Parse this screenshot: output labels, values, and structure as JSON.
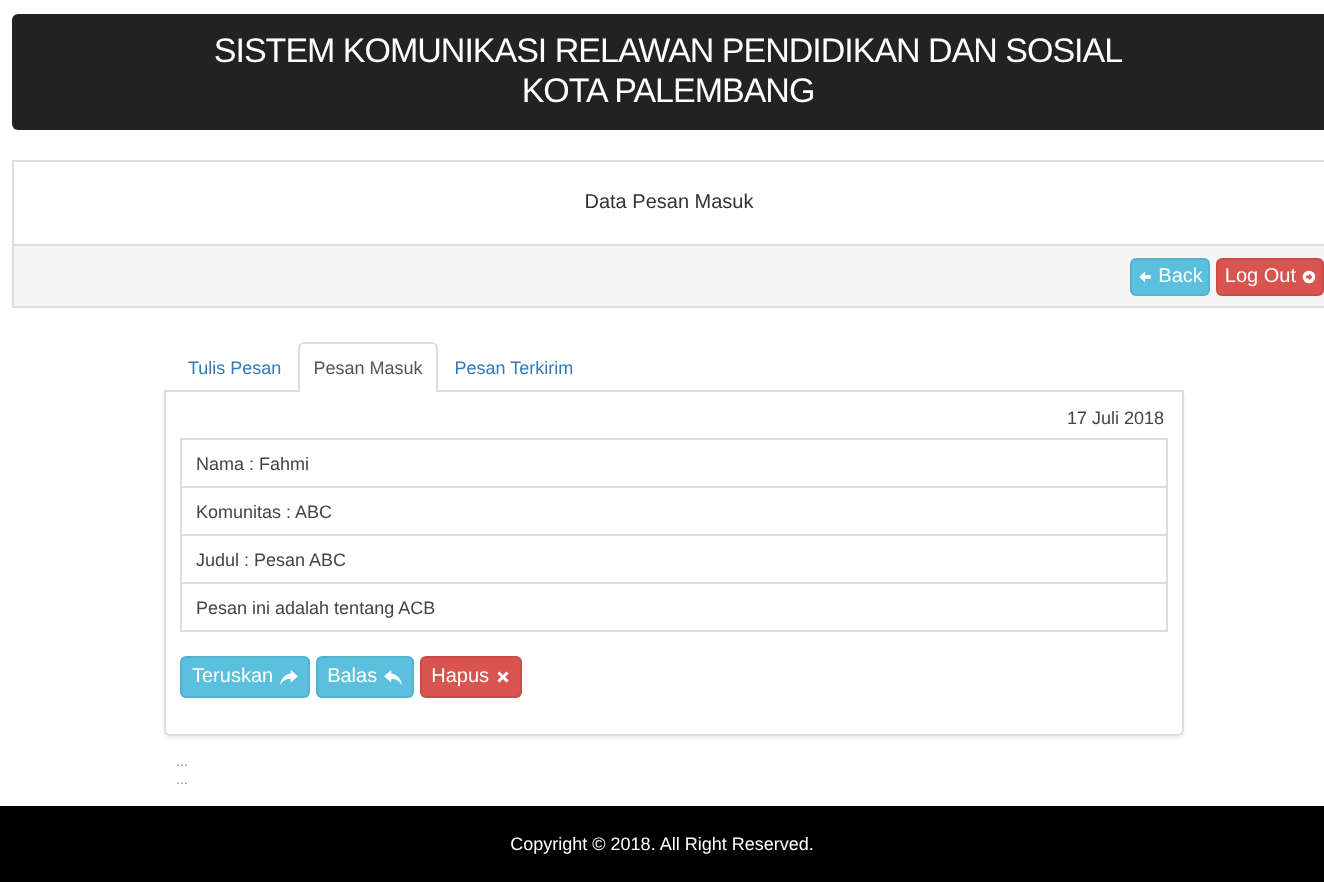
{
  "header": {
    "title_lines": [
      "SISTEM KOMUNIKASI RELAWAN PENDIDIKAN DAN SOSIAL",
      "KOTA PALEMBANG"
    ]
  },
  "page_title": "Data Pesan Masuk",
  "toolbar": {
    "buttons": [
      {
        "label": "Back",
        "kind": "info"
      },
      {
        "label": "Log Out",
        "kind": "danger"
      }
    ]
  },
  "tabs": [
    {
      "label": "Tulis Pesan",
      "selected": false
    },
    {
      "label": "Pesan Masuk",
      "selected": true
    },
    {
      "label": "Pesan Terkirim",
      "selected": false
    }
  ],
  "message": {
    "date": "17 Juli 2018",
    "fields": [
      "Nama : Fahmi",
      "Komunitas : ABC",
      "Judul : Pesan ABC",
      "Pesan ini adalah tentang ACB"
    ],
    "actions": [
      {
        "label": "Teruskan",
        "kind": "info"
      },
      {
        "label": "Balas",
        "kind": "info"
      },
      {
        "label": "Hapus",
        "kind": "danger"
      }
    ]
  },
  "notes": [
    "...",
    "..."
  ],
  "footer": "Copyright © 2018. All Right Reserved."
}
